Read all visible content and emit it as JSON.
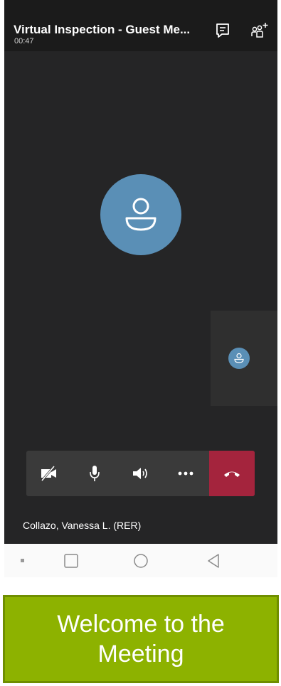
{
  "header": {
    "title": "Virtual Inspection - Guest Me...",
    "timer": "00:47",
    "chat_icon": "chat-icon",
    "add_people_icon": "add-people-icon"
  },
  "participants": {
    "main_avatar_icon": "person-icon",
    "self_avatar_icon": "person-icon",
    "name": "Collazo, Vanessa L. (RER)"
  },
  "controls": {
    "video_icon": "video-off-icon",
    "mic_icon": "microphone-icon",
    "speaker_icon": "speaker-icon",
    "more_icon": "more-icon",
    "hangup_icon": "hang-up-icon"
  },
  "nav_bar": {
    "menu_icon": "menu-icon",
    "home_icon": "square-icon",
    "recents_icon": "circle-icon",
    "back_icon": "back-triangle-icon"
  },
  "banner": {
    "text": "Welcome to the Meeting"
  },
  "colors": {
    "screen_bg": "#252526",
    "header_bg": "#1b1b1b",
    "avatar": "#5a8fb6",
    "controls_bg": "#3a3a3a",
    "hangup": "#a4243d",
    "banner": "#8db200"
  }
}
